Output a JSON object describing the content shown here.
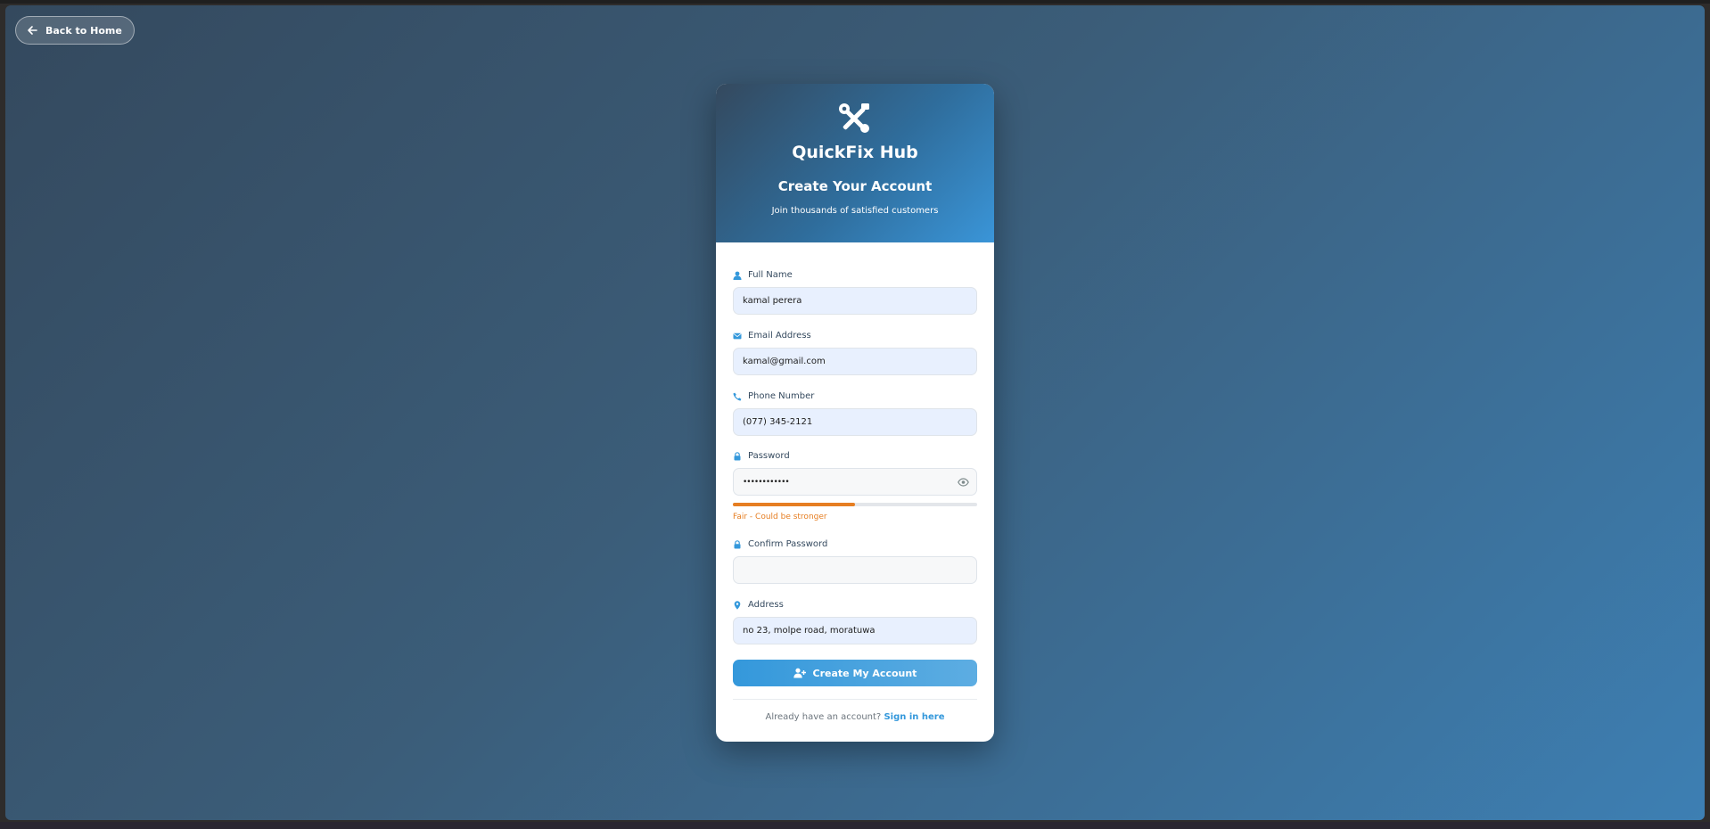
{
  "nav": {
    "back_label": "Back to Home"
  },
  "header": {
    "brand": "QuickFix Hub",
    "title": "Create Your Account",
    "subtitle": "Join thousands of satisfied customers",
    "logo_icon": "tools-icon"
  },
  "form": {
    "full_name": {
      "label": "Full Name",
      "value": "kamal perera",
      "icon": "user-icon"
    },
    "email": {
      "label": "Email Address",
      "value": "kamal@gmail.com",
      "icon": "envelope-icon"
    },
    "phone": {
      "label": "Phone Number",
      "value": "(077) 345-2121",
      "icon": "phone-icon"
    },
    "password": {
      "label": "Password",
      "value": "••••••••••••",
      "icon": "lock-icon",
      "toggle_icon": "eye-icon"
    },
    "strength": {
      "level": 0.5,
      "text": "Fair - Could be stronger",
      "color": "#e67e22"
    },
    "confirm_password": {
      "label": "Confirm Password",
      "value": "",
      "icon": "lock-icon"
    },
    "address": {
      "label": "Address",
      "value": "no 23, molpe road, moratuwa",
      "icon": "map-marker-icon"
    },
    "submit_label": "Create My Account",
    "submit_icon": "user-plus-icon"
  },
  "footer": {
    "prompt": "Already have an account?",
    "link": "Sign in here"
  },
  "colors": {
    "accent": "#3498db",
    "header_dark": "#34495e",
    "warning": "#e67e22"
  }
}
